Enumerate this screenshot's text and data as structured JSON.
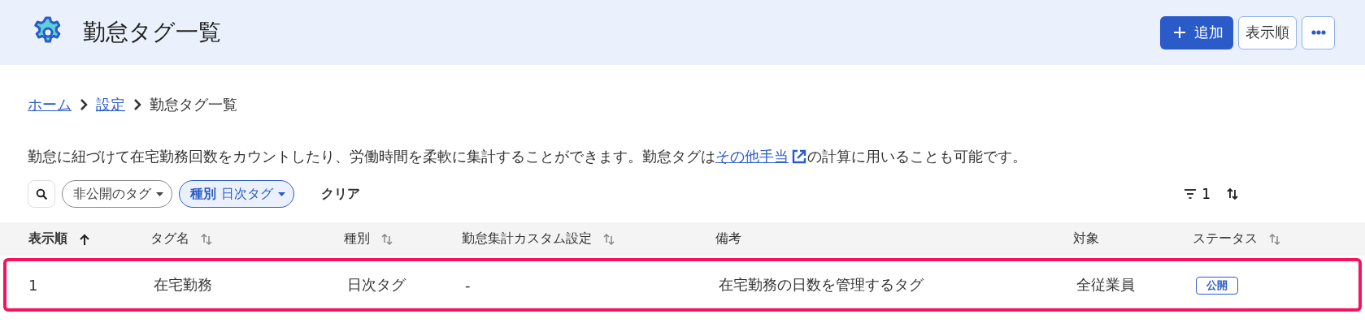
{
  "header": {
    "title": "勤怠タグ一覧",
    "actions": [
      {
        "kind": "primary",
        "label": "追加"
      },
      {
        "kind": "secondary",
        "label": "表示順"
      },
      {
        "kind": "more"
      }
    ]
  },
  "breadcrumb": [
    {
      "label": "ホーム",
      "link": true
    },
    {
      "label": "設定",
      "link": true
    },
    {
      "label": "勤怠タグ一覧",
      "link": false
    }
  ],
  "description": {
    "before": "勤怠に紐づけて在宅勤務回数をカウントしたり、労働時間を柔軟に集計することができます。勤怠タグは",
    "link": "その他手当",
    "after": "の計算に用いることも可能です。"
  },
  "filters": {
    "chips": [
      {
        "label": "非公開のタグ",
        "active": false
      },
      {
        "label": "種別",
        "value": "日次タグ",
        "active": true
      }
    ],
    "clear": "クリア",
    "filter_count": "1"
  },
  "table": {
    "columns": [
      {
        "label": "表示順",
        "sortable": true,
        "sorted": true
      },
      {
        "label": "タグ名",
        "sortable": true,
        "sorted": false
      },
      {
        "label": "種別",
        "sortable": true,
        "sorted": false
      },
      {
        "label": "勤怠集計カスタム設定",
        "sortable": true,
        "sorted": false
      },
      {
        "label": "備考",
        "sortable": false,
        "sorted": false
      },
      {
        "label": "対象",
        "sortable": false,
        "sorted": false
      },
      {
        "label": "ステータス",
        "sortable": true,
        "sorted": false
      }
    ],
    "rows": [
      {
        "highlighted": true,
        "cells": [
          "1",
          "在宅勤務",
          "日次タグ",
          "-",
          "在宅勤務の日数を管理するタグ",
          "全従業員"
        ],
        "status": "公開"
      }
    ]
  }
}
